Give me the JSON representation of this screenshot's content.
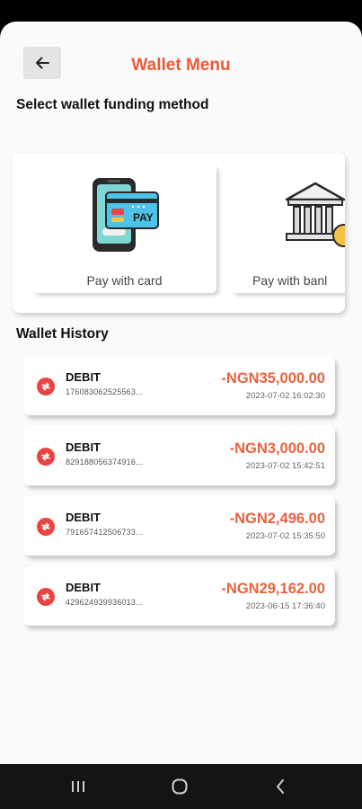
{
  "header": {
    "title": "Wallet Menu"
  },
  "funding": {
    "title": "Select wallet funding method",
    "methods": [
      {
        "label": "Pay with card",
        "icon": "card-payment-icon"
      },
      {
        "label": "Pay with banl",
        "icon": "bank-icon"
      }
    ]
  },
  "history": {
    "title": "Wallet History",
    "items": [
      {
        "type": "DEBIT",
        "ref": "176083062525563...",
        "amount": "-NGN35,000.00",
        "date": "2023-07-02 16:02:30"
      },
      {
        "type": "DEBIT",
        "ref": "829188056374916...",
        "amount": "-NGN3,000.00",
        "date": "2023-07-02 15:42:51"
      },
      {
        "type": "DEBIT",
        "ref": "791657412506733...",
        "amount": "-NGN2,496.00",
        "date": "2023-07-02 15:35:50"
      },
      {
        "type": "DEBIT",
        "ref": "429624939936013...",
        "amount": "-NGN29,162.00",
        "date": "2023-06-15 17:36:40"
      }
    ]
  },
  "colors": {
    "accent": "#ea5a37",
    "debit": "#e94343",
    "amount": "#e8623f"
  }
}
